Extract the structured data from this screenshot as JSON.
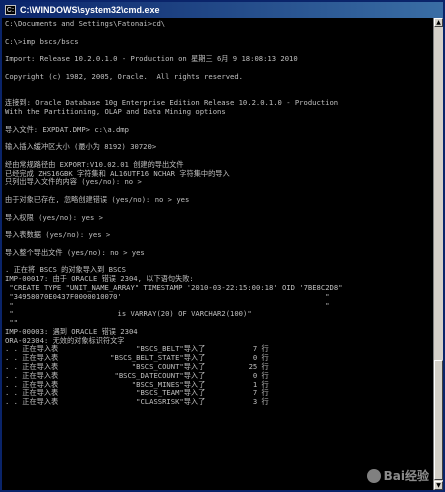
{
  "window": {
    "title": "C:\\WINDOWS\\system32\\cmd.exe",
    "icon": "console-icon"
  },
  "console": {
    "lines": [
      "C:\\Documents and Settings\\Fatonai>cd\\",
      "",
      "C:\\>imp bscs/bscs",
      "",
      "Import: Release 10.2.0.1.0 - Production on 星期三 6月 9 18:08:13 2010",
      "",
      "Copyright (c) 1982, 2005, Oracle.  All rights reserved.",
      "",
      "",
      "连接到: Oracle Database 10g Enterprise Edition Release 10.2.0.1.0 - Production",
      "With the Partitioning, OLAP and Data Mining options",
      "",
      "导入文件: EXPDAT.DMP> c:\\a.dmp",
      "",
      "输入插入缓冲区大小 (最小为 8192) 30720>",
      "",
      "经由常规路径由 EXPORT:V10.02.01 创建的导出文件",
      "已经完成 ZHS16GBK 字符集和 AL16UTF16 NCHAR 字符集中的导入",
      "只列出导入文件的内容 (yes/no): no >",
      "",
      "由于对象已存在, 忽略创建错误 (yes/no): no > yes",
      "",
      "导入权限 (yes/no): yes >",
      "",
      "导入表数据 (yes/no): yes >",
      "",
      "导入整个导出文件 (yes/no): no > yes",
      "",
      ". 正在将 BSCS 的对象导入到 BSCS",
      "IMP-00017: 由于 ORACLE 错误 2304, 以下语句失败:",
      " \"CREATE TYPE \"UNIT_NAME_ARRAY\" TIMESTAMP '2010-03-22:15:00:18' OID '7BE8C2D8\"",
      " \"34958070E0437F0000010070'                                               \"",
      " \"                                                                        \"",
      " \"                        is VARRAY(20) OF VARCHAR2(100)\"",
      " \"\"",
      "IMP-00003: 遇到 ORACLE 错误 2304",
      "ORA-02304: 无效的对象标识符文字",
      ". . 正在导入表                  \"BSCS_BELT\"导入了           7 行",
      ". . 正在导入表            \"BSCS_BELT_STATE\"导入了           0 行",
      ". . 正在导入表                 \"BSCS_COUNT\"导入了          25 行",
      ". . 正在导入表             \"BSCS_DATECOUNT\"导入了           0 行",
      ". . 正在导入表                 \"BSCS_MINES\"导入了           1 行",
      ". . 正在导入表                  \"BSCS_TEAM\"导入了           7 行",
      ". . 正在导入表                  \"CLASSRISK\"导入了           3 行"
    ]
  },
  "watermark": {
    "text": "Bai经验"
  },
  "colors": {
    "console_bg": "#000000",
    "console_fg": "#c0c0c0",
    "titlebar_start": "#0a246a",
    "titlebar_end": "#3a6ea5"
  }
}
